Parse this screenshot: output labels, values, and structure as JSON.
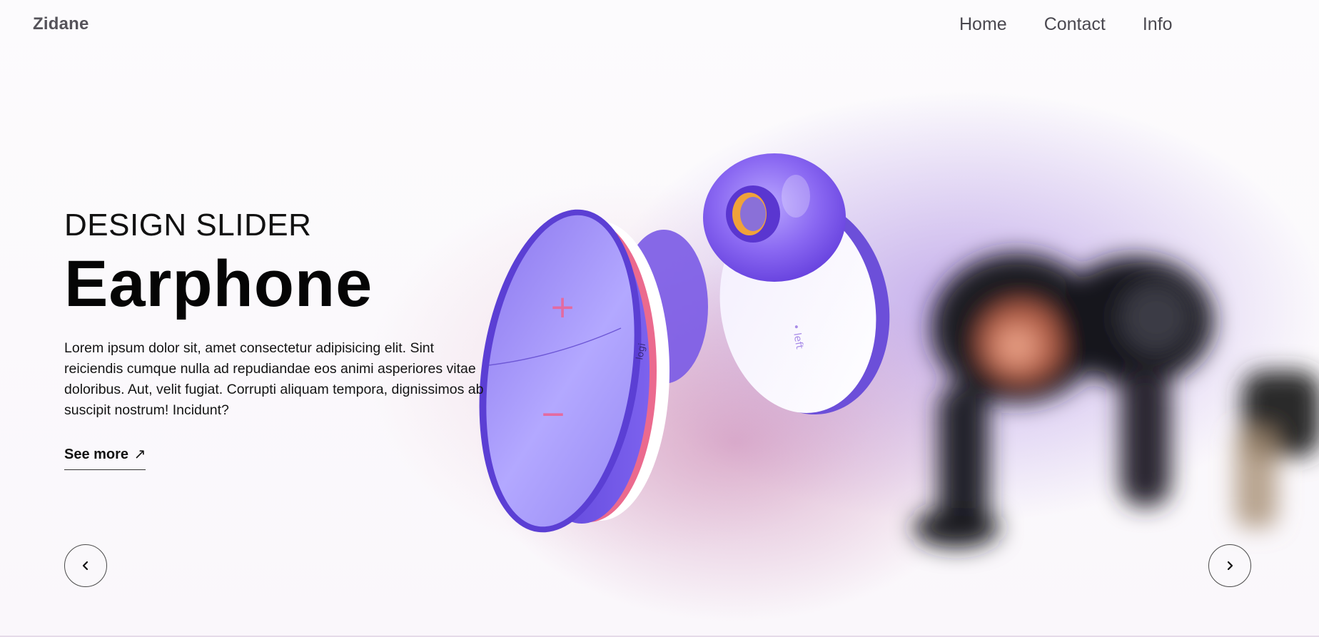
{
  "header": {
    "logo": "Zidane",
    "nav": [
      "Home",
      "Contact",
      "Info"
    ]
  },
  "hero": {
    "eyebrow": "DESIGN SLIDER",
    "title": "Earphone",
    "description": "Lorem ipsum dolor sit, amet consectetur adipisicing elit. Sint reiciendis cumque nulla ad repudiandae eos animi asperiores vitae doloribus. Aut, velit fugiat. Corrupti aliquam tempora, dignissimos ab suscipit nostrum! Incidunt?",
    "cta": "See more",
    "cta_arrow": "↗"
  },
  "product_image": {
    "left_bud": {
      "plus": "+",
      "minus": "−",
      "brand": "logi"
    },
    "right_bud": {
      "side": "• left"
    }
  },
  "controls": {
    "prev_icon": "chevron-left-icon",
    "next_icon": "chevron-right-icon"
  },
  "colors": {
    "accent_purple": "#7a5ae6",
    "accent_pink": "#e8507a",
    "text_dark": "#111111"
  }
}
